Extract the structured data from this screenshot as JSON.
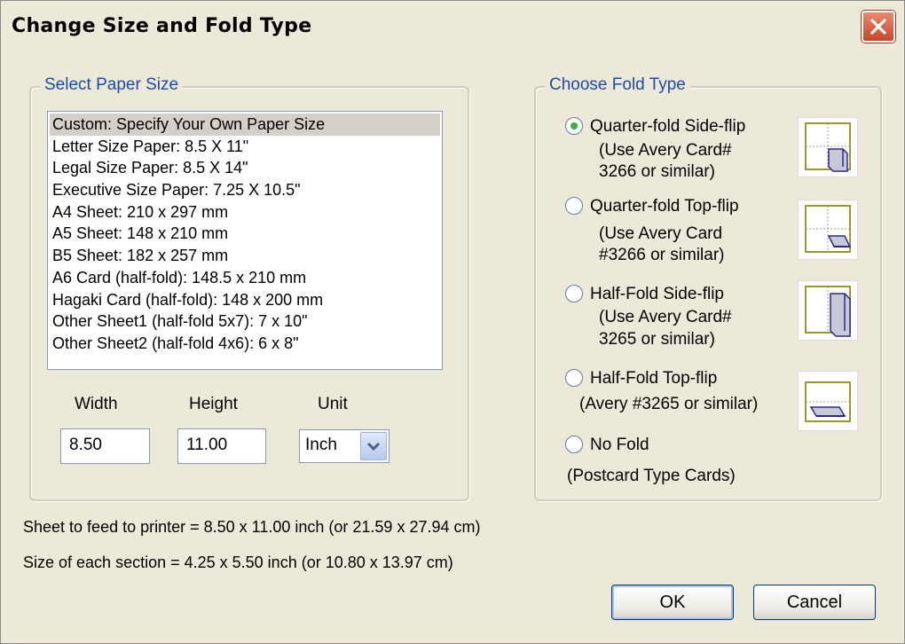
{
  "window": {
    "title": "Change Size and Fold Type"
  },
  "paper_size": {
    "group_title": "Select Paper Size",
    "items": [
      "Custom: Specify Your Own Paper Size",
      "Letter Size Paper: 8.5 X 11\"",
      "Legal Size Paper: 8.5 X 14\"",
      "Executive Size Paper: 7.25   X 10.5\"",
      "A4 Sheet: 210 x 297 mm",
      "A5 Sheet: 148 x 210 mm",
      "B5 Sheet: 182 x 257 mm",
      "A6 Card (half-fold): 148.5 x 210 mm",
      "Hagaki Card (half-fold): 148 x 200 mm",
      "Other Sheet1 (half-fold 5x7): 7 x 10\"",
      "Other Sheet2 (half-fold 4x6): 6 x 8\""
    ],
    "selected_index": 0,
    "width_label": "Width",
    "height_label": "Height",
    "unit_label": "Unit",
    "width_value": "8.50",
    "height_value": "11.00",
    "unit_value": "Inch"
  },
  "fold_type": {
    "group_title": "Choose Fold Type",
    "options": [
      {
        "line1": "Quarter-fold Side-flip",
        "line2": "(Use Avery Card#",
        "line3": "3266 or similar)",
        "selected": true,
        "icon": "quarter-fold-side-flip-icon"
      },
      {
        "line1": "Quarter-fold Top-flip",
        "line2": "(Use Avery Card",
        "line3": "#3266 or similar)",
        "selected": false,
        "icon": "quarter-fold-top-flip-icon"
      },
      {
        "line1": "Half-Fold Side-flip",
        "line2": "(Use Avery Card#",
        "line3": "3265 or similar)",
        "selected": false,
        "icon": "half-fold-side-flip-icon"
      },
      {
        "line1": "Half-Fold Top-flip",
        "line2": "(Avery #3265 or similar)",
        "line3": "",
        "selected": false,
        "icon": "half-fold-top-flip-icon"
      },
      {
        "line1": "No Fold",
        "line2": "(Postcard Type Cards)",
        "line3": "",
        "selected": false,
        "icon": ""
      }
    ]
  },
  "info": {
    "sheet": "Sheet to feed to printer = 8.50 x 11.00 inch (or 21.59 x 27.94 cm)",
    "section": "Size of each section = 4.25 x 5.50 inch (or 10.80 x 13.97 cm)"
  },
  "buttons": {
    "ok": "OK",
    "cancel": "Cancel"
  },
  "colors": {
    "group_title": "#1c4ba8",
    "radio_selected": "#3cae3a",
    "close_button": "#c9452a"
  }
}
